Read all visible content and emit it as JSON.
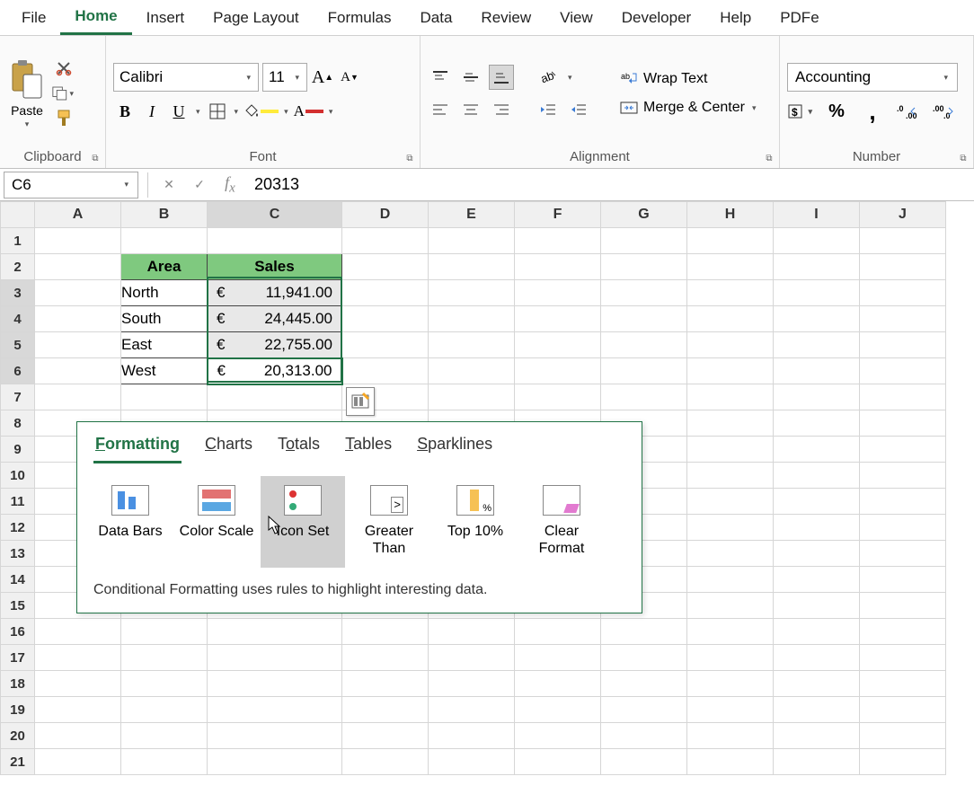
{
  "ribbon": {
    "tabs": [
      "File",
      "Home",
      "Insert",
      "Page Layout",
      "Formulas",
      "Data",
      "Review",
      "View",
      "Developer",
      "Help",
      "PDFe"
    ],
    "active_tab": "Home",
    "clipboard": {
      "paste": "Paste",
      "group": "Clipboard"
    },
    "font": {
      "name": "Calibri",
      "size": "11",
      "group": "Font"
    },
    "alignment": {
      "wrap": "Wrap Text",
      "merge": "Merge & Center",
      "group": "Alignment"
    },
    "number": {
      "format": "Accounting",
      "group": "Number"
    }
  },
  "formula_bar": {
    "name_box": "C6",
    "value": "20313"
  },
  "grid": {
    "columns": [
      "A",
      "B",
      "C",
      "D",
      "E",
      "F",
      "G",
      "H",
      "I",
      "J"
    ],
    "rows": 21,
    "selected_rows": [
      3,
      4,
      5,
      6
    ],
    "selected_col": "C",
    "headers": {
      "b2": "Area",
      "c2": "Sales"
    },
    "data": [
      {
        "area": "North",
        "currency": "€",
        "sales": "11,941.00"
      },
      {
        "area": "South",
        "currency": "€",
        "sales": "24,445.00"
      },
      {
        "area": "East",
        "currency": "€",
        "sales": "22,755.00"
      },
      {
        "area": "West",
        "currency": "€",
        "sales": "20,313.00"
      }
    ]
  },
  "quick_analysis": {
    "tabs": [
      {
        "label": "Formatting",
        "accel": "F"
      },
      {
        "label": "Charts",
        "accel": "C"
      },
      {
        "label": "Totals",
        "accel": "o"
      },
      {
        "label": "Tables",
        "accel": "T"
      },
      {
        "label": "Sparklines",
        "accel": "S"
      }
    ],
    "active_tab": "Formatting",
    "items": [
      {
        "label": "Data Bars"
      },
      {
        "label": "Color Scale"
      },
      {
        "label": "Icon Set"
      },
      {
        "label": "Greater Than"
      },
      {
        "label": "Top 10%"
      },
      {
        "label": "Clear Format"
      }
    ],
    "hover_item": "Icon Set",
    "description": "Conditional Formatting uses rules to highlight interesting data."
  }
}
